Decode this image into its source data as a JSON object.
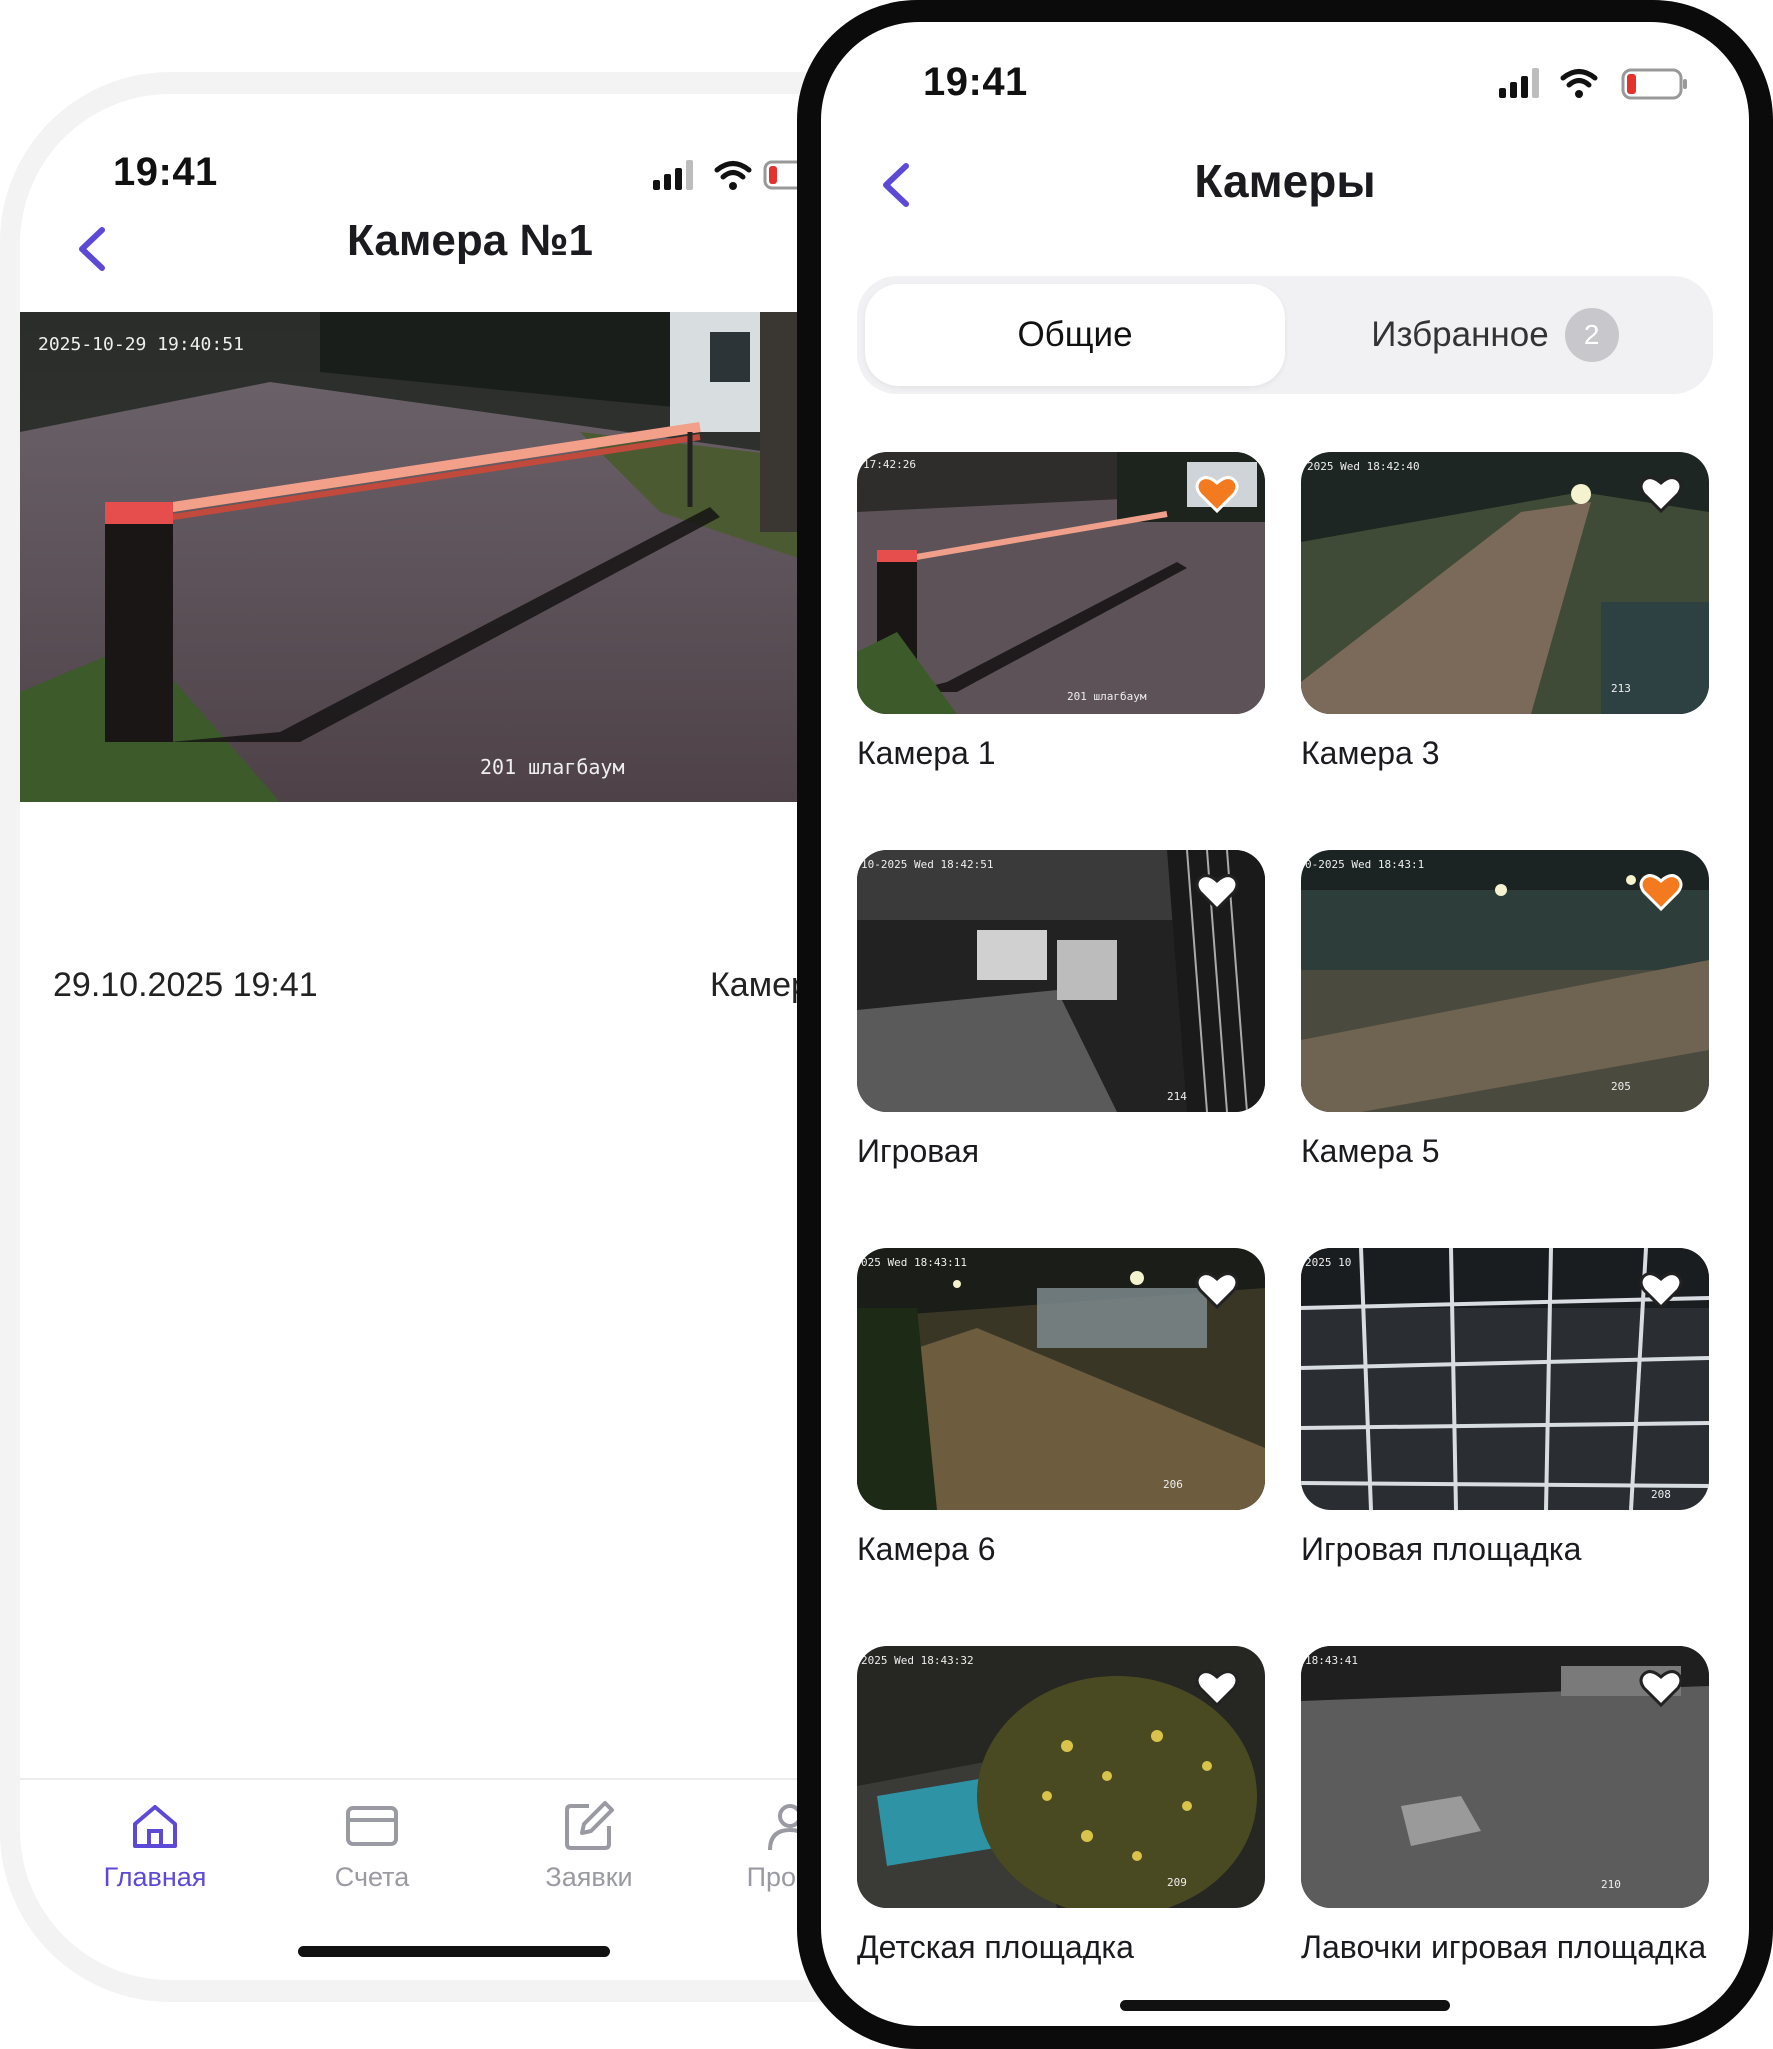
{
  "back_phone": {
    "status_time": "19:41",
    "title": "Камера №1",
    "video_overlay": {
      "timestamp": "2025-10-29 19:40:51",
      "caption": "201 шлагбаум"
    },
    "info": {
      "date": "29.10.2025 19:41",
      "camera_name": "Камер"
    },
    "tabs": [
      {
        "label": "Главная",
        "icon": "home-icon",
        "active": true
      },
      {
        "label": "Счета",
        "icon": "card-icon",
        "active": false
      },
      {
        "label": "Заявки",
        "icon": "edit-icon",
        "active": false
      },
      {
        "label": "Профи",
        "icon": "profile-icon",
        "active": false
      }
    ],
    "colors": {
      "accent": "#5c49d6",
      "inactive": "#9a9aa2"
    }
  },
  "front_phone": {
    "status_time": "19:41",
    "title": "Камеры",
    "segment": {
      "general": "Общие",
      "favorites": "Избранное",
      "favorites_count": "2"
    },
    "cameras": [
      {
        "label": "Камера 1",
        "favorite": true,
        "osd_time": "17:42:26",
        "osd_caption": "201 шлагбаум"
      },
      {
        "label": "Камера 3",
        "favorite": false,
        "osd_time": "2025 Wed 18:42:40",
        "osd_caption": "213"
      },
      {
        "label": "Игровая",
        "favorite": false,
        "osd_time": "10-2025 Wed 18:42:51",
        "osd_caption": "214"
      },
      {
        "label": "Камера 5",
        "favorite": true,
        "osd_time": "0-2025 Wed 18:43:1",
        "osd_caption": "205"
      },
      {
        "label": "Камера 6",
        "favorite": false,
        "osd_time": "025 Wed 18:43:11",
        "osd_caption": "206"
      },
      {
        "label": "Игровая площадка",
        "favorite": false,
        "osd_time": "2025 10",
        "osd_caption": "208"
      },
      {
        "label": "Детская площадка",
        "favorite": false,
        "osd_time": "2025 Wed 18:43:32",
        "osd_caption": "209"
      },
      {
        "label": "Лавочки игровая площадка",
        "favorite": false,
        "osd_time": "18:43:41",
        "osd_caption": "210"
      }
    ],
    "colors": {
      "accent": "#5c49d6",
      "favorite": "#f47a1f",
      "badge": "#c7c7cc"
    }
  }
}
